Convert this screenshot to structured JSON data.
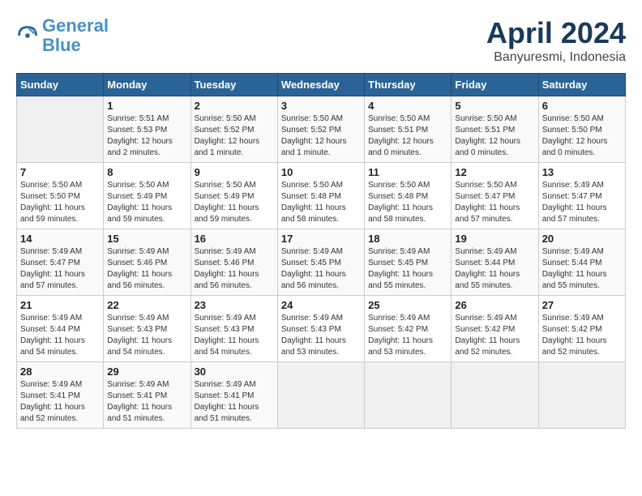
{
  "header": {
    "logo_line1": "General",
    "logo_line2": "Blue",
    "month": "April 2024",
    "location": "Banyuresmi, Indonesia"
  },
  "weekdays": [
    "Sunday",
    "Monday",
    "Tuesday",
    "Wednesday",
    "Thursday",
    "Friday",
    "Saturday"
  ],
  "weeks": [
    [
      {
        "day": "",
        "info": ""
      },
      {
        "day": "1",
        "info": "Sunrise: 5:51 AM\nSunset: 5:53 PM\nDaylight: 12 hours\nand 2 minutes."
      },
      {
        "day": "2",
        "info": "Sunrise: 5:50 AM\nSunset: 5:52 PM\nDaylight: 12 hours\nand 1 minute."
      },
      {
        "day": "3",
        "info": "Sunrise: 5:50 AM\nSunset: 5:52 PM\nDaylight: 12 hours\nand 1 minute."
      },
      {
        "day": "4",
        "info": "Sunrise: 5:50 AM\nSunset: 5:51 PM\nDaylight: 12 hours\nand 0 minutes."
      },
      {
        "day": "5",
        "info": "Sunrise: 5:50 AM\nSunset: 5:51 PM\nDaylight: 12 hours\nand 0 minutes."
      },
      {
        "day": "6",
        "info": "Sunrise: 5:50 AM\nSunset: 5:50 PM\nDaylight: 12 hours\nand 0 minutes."
      }
    ],
    [
      {
        "day": "7",
        "info": "Sunrise: 5:50 AM\nSunset: 5:50 PM\nDaylight: 11 hours\nand 59 minutes."
      },
      {
        "day": "8",
        "info": "Sunrise: 5:50 AM\nSunset: 5:49 PM\nDaylight: 11 hours\nand 59 minutes."
      },
      {
        "day": "9",
        "info": "Sunrise: 5:50 AM\nSunset: 5:49 PM\nDaylight: 11 hours\nand 59 minutes."
      },
      {
        "day": "10",
        "info": "Sunrise: 5:50 AM\nSunset: 5:48 PM\nDaylight: 11 hours\nand 58 minutes."
      },
      {
        "day": "11",
        "info": "Sunrise: 5:50 AM\nSunset: 5:48 PM\nDaylight: 11 hours\nand 58 minutes."
      },
      {
        "day": "12",
        "info": "Sunrise: 5:50 AM\nSunset: 5:47 PM\nDaylight: 11 hours\nand 57 minutes."
      },
      {
        "day": "13",
        "info": "Sunrise: 5:49 AM\nSunset: 5:47 PM\nDaylight: 11 hours\nand 57 minutes."
      }
    ],
    [
      {
        "day": "14",
        "info": "Sunrise: 5:49 AM\nSunset: 5:47 PM\nDaylight: 11 hours\nand 57 minutes."
      },
      {
        "day": "15",
        "info": "Sunrise: 5:49 AM\nSunset: 5:46 PM\nDaylight: 11 hours\nand 56 minutes."
      },
      {
        "day": "16",
        "info": "Sunrise: 5:49 AM\nSunset: 5:46 PM\nDaylight: 11 hours\nand 56 minutes."
      },
      {
        "day": "17",
        "info": "Sunrise: 5:49 AM\nSunset: 5:45 PM\nDaylight: 11 hours\nand 56 minutes."
      },
      {
        "day": "18",
        "info": "Sunrise: 5:49 AM\nSunset: 5:45 PM\nDaylight: 11 hours\nand 55 minutes."
      },
      {
        "day": "19",
        "info": "Sunrise: 5:49 AM\nSunset: 5:44 PM\nDaylight: 11 hours\nand 55 minutes."
      },
      {
        "day": "20",
        "info": "Sunrise: 5:49 AM\nSunset: 5:44 PM\nDaylight: 11 hours\nand 55 minutes."
      }
    ],
    [
      {
        "day": "21",
        "info": "Sunrise: 5:49 AM\nSunset: 5:44 PM\nDaylight: 11 hours\nand 54 minutes."
      },
      {
        "day": "22",
        "info": "Sunrise: 5:49 AM\nSunset: 5:43 PM\nDaylight: 11 hours\nand 54 minutes."
      },
      {
        "day": "23",
        "info": "Sunrise: 5:49 AM\nSunset: 5:43 PM\nDaylight: 11 hours\nand 54 minutes."
      },
      {
        "day": "24",
        "info": "Sunrise: 5:49 AM\nSunset: 5:43 PM\nDaylight: 11 hours\nand 53 minutes."
      },
      {
        "day": "25",
        "info": "Sunrise: 5:49 AM\nSunset: 5:42 PM\nDaylight: 11 hours\nand 53 minutes."
      },
      {
        "day": "26",
        "info": "Sunrise: 5:49 AM\nSunset: 5:42 PM\nDaylight: 11 hours\nand 52 minutes."
      },
      {
        "day": "27",
        "info": "Sunrise: 5:49 AM\nSunset: 5:42 PM\nDaylight: 11 hours\nand 52 minutes."
      }
    ],
    [
      {
        "day": "28",
        "info": "Sunrise: 5:49 AM\nSunset: 5:41 PM\nDaylight: 11 hours\nand 52 minutes."
      },
      {
        "day": "29",
        "info": "Sunrise: 5:49 AM\nSunset: 5:41 PM\nDaylight: 11 hours\nand 51 minutes."
      },
      {
        "day": "30",
        "info": "Sunrise: 5:49 AM\nSunset: 5:41 PM\nDaylight: 11 hours\nand 51 minutes."
      },
      {
        "day": "",
        "info": ""
      },
      {
        "day": "",
        "info": ""
      },
      {
        "day": "",
        "info": ""
      },
      {
        "day": "",
        "info": ""
      }
    ]
  ]
}
